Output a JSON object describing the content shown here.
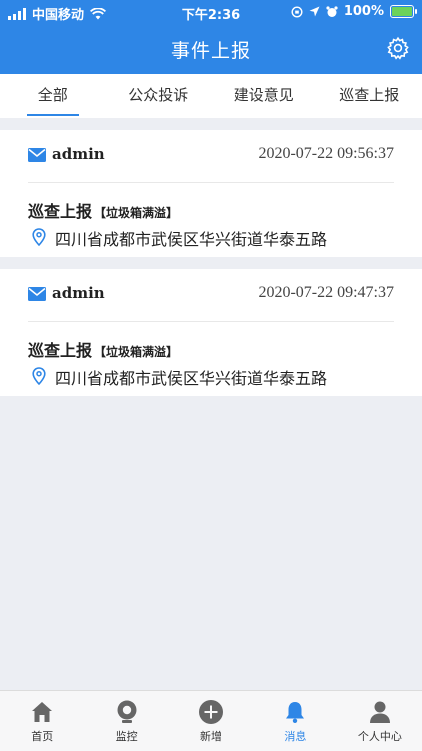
{
  "status_bar": {
    "carrier": "中国移动",
    "time": "下午2:36",
    "battery": "100%"
  },
  "header": {
    "title": "事件上报",
    "settings_icon": "gear-icon"
  },
  "tabs": [
    {
      "label": "全部"
    },
    {
      "label": "公众投诉"
    },
    {
      "label": "建设意见"
    },
    {
      "label": "巡查上报"
    }
  ],
  "events": [
    {
      "user": "admin",
      "time": "2020-07-22 09:56:37",
      "type": "巡查上报",
      "tag": "【垃圾箱满溢】",
      "address": "四川省成都市武侯区华兴街道华泰五路"
    },
    {
      "user": "admin",
      "time": "2020-07-22 09:47:37",
      "type": "巡查上报",
      "tag": "【垃圾箱满溢】",
      "address": "四川省成都市武侯区华兴街道华泰五路"
    }
  ],
  "tabbar": [
    {
      "label": "首页",
      "icon": "home-icon"
    },
    {
      "label": "监控",
      "icon": "monitor-icon"
    },
    {
      "label": "新增",
      "icon": "add-icon"
    },
    {
      "label": "消息",
      "icon": "bell-icon"
    },
    {
      "label": "个人中心",
      "icon": "user-icon"
    }
  ],
  "colors": {
    "accent": "#2e86e6",
    "background": "#eceef3"
  }
}
